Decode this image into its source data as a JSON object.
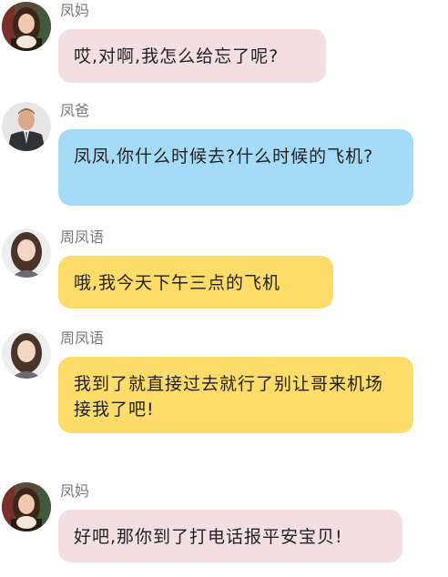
{
  "colors": {
    "mom_bubble": "#f3dfe0",
    "dad_bubble": "#a6dbf7",
    "self_bubble": "#fedc69",
    "sender_text": "#777777"
  },
  "messages": [
    {
      "sender": "凤妈",
      "avatar": "mom-avatar",
      "text": "哎,对啊,我怎么给忘了呢?"
    },
    {
      "sender": "凤爸",
      "avatar": "dad-avatar",
      "text": "凤凤,你什么时候去?什么时候的飞机?"
    },
    {
      "sender": "周凤语",
      "avatar": "girl-avatar",
      "text": "哦,我今天下午三点的飞机"
    },
    {
      "sender": "周凤语",
      "avatar": "girl-avatar",
      "text": "我到了就直接过去就行了别让哥来机场接我了吧!"
    },
    {
      "sender": "凤妈",
      "avatar": "mom-avatar",
      "text": "好吧,那你到了打电话报平安宝贝!"
    }
  ]
}
